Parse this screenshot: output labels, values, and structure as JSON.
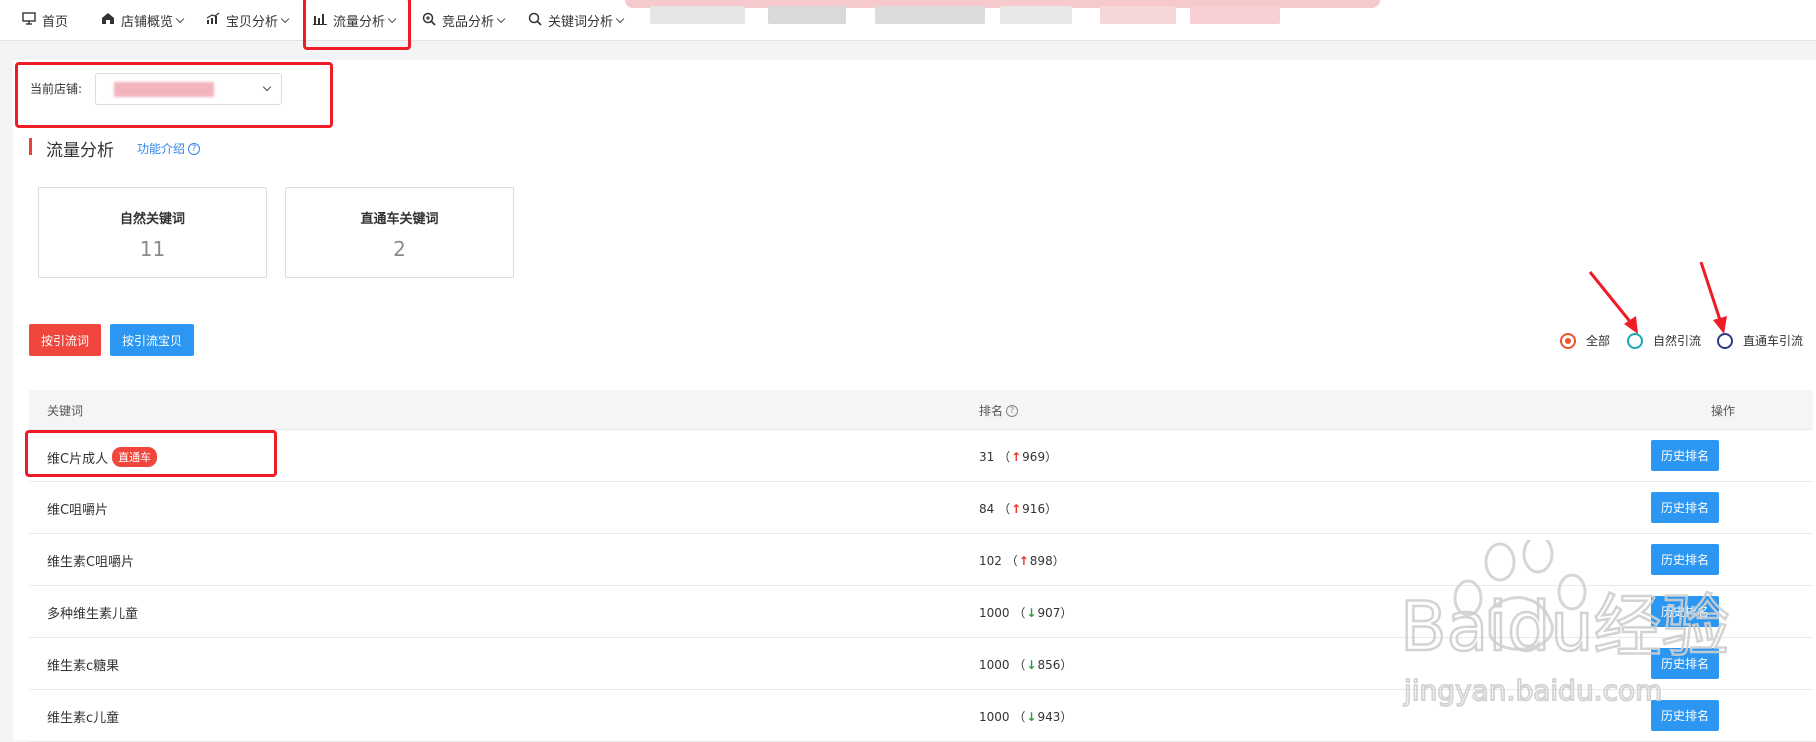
{
  "nav": {
    "items": [
      {
        "label": "首页",
        "icon": "monitor-icon",
        "dropdown": false
      },
      {
        "label": "店铺概览",
        "icon": "store-icon",
        "dropdown": true
      },
      {
        "label": "宝贝分析",
        "icon": "trend-icon",
        "dropdown": true
      },
      {
        "label": "流量分析",
        "icon": "bar-chart-icon",
        "dropdown": true
      },
      {
        "label": "竞品分析",
        "icon": "zoom-icon",
        "dropdown": true
      },
      {
        "label": "关键词分析",
        "icon": "search-icon",
        "dropdown": true
      }
    ]
  },
  "shop": {
    "label": "当前店铺:"
  },
  "section": {
    "title": "流量分析",
    "help_link": "功能介绍"
  },
  "stats": [
    {
      "label": "自然关键词",
      "value": "11"
    },
    {
      "label": "直通车关键词",
      "value": "2"
    }
  ],
  "buttons": {
    "by_keyword": "按引流词",
    "by_item": "按引流宝贝"
  },
  "filter": {
    "options": [
      "全部",
      "自然引流",
      "直通车引流"
    ],
    "selected": "全部"
  },
  "table": {
    "headers": [
      "关键词",
      "排名",
      "操作"
    ],
    "rows": [
      {
        "keyword": "维C片成人",
        "tag": "直通车",
        "rank": "31",
        "change": "969",
        "dir": "up",
        "action": "历史排名"
      },
      {
        "keyword": "维C咀嚼片",
        "tag": "",
        "rank": "84",
        "change": "916",
        "dir": "up",
        "action": "历史排名"
      },
      {
        "keyword": "维生素C咀嚼片",
        "tag": "",
        "rank": "102",
        "change": "898",
        "dir": "up",
        "action": "历史排名"
      },
      {
        "keyword": "多种维生素儿童",
        "tag": "",
        "rank": "1000",
        "change": "907",
        "dir": "down",
        "action": "历史排名"
      },
      {
        "keyword": "维生素c糖果",
        "tag": "",
        "rank": "1000",
        "change": "856",
        "dir": "down",
        "action": "历史排名"
      },
      {
        "keyword": "维生素c儿童",
        "tag": "",
        "rank": "1000",
        "change": "943",
        "dir": "down",
        "action": "历史排名"
      }
    ]
  },
  "watermark": {
    "brand": "Baidu经验",
    "url": "jingyan.baidu.com"
  },
  "colors": {
    "accent_red": "#f0463d",
    "accent_blue": "#2b97f2",
    "link_blue": "#2f86e8",
    "annotation_red": "#ee1c25",
    "up": "#e8332a",
    "down": "#2e9e3b"
  }
}
